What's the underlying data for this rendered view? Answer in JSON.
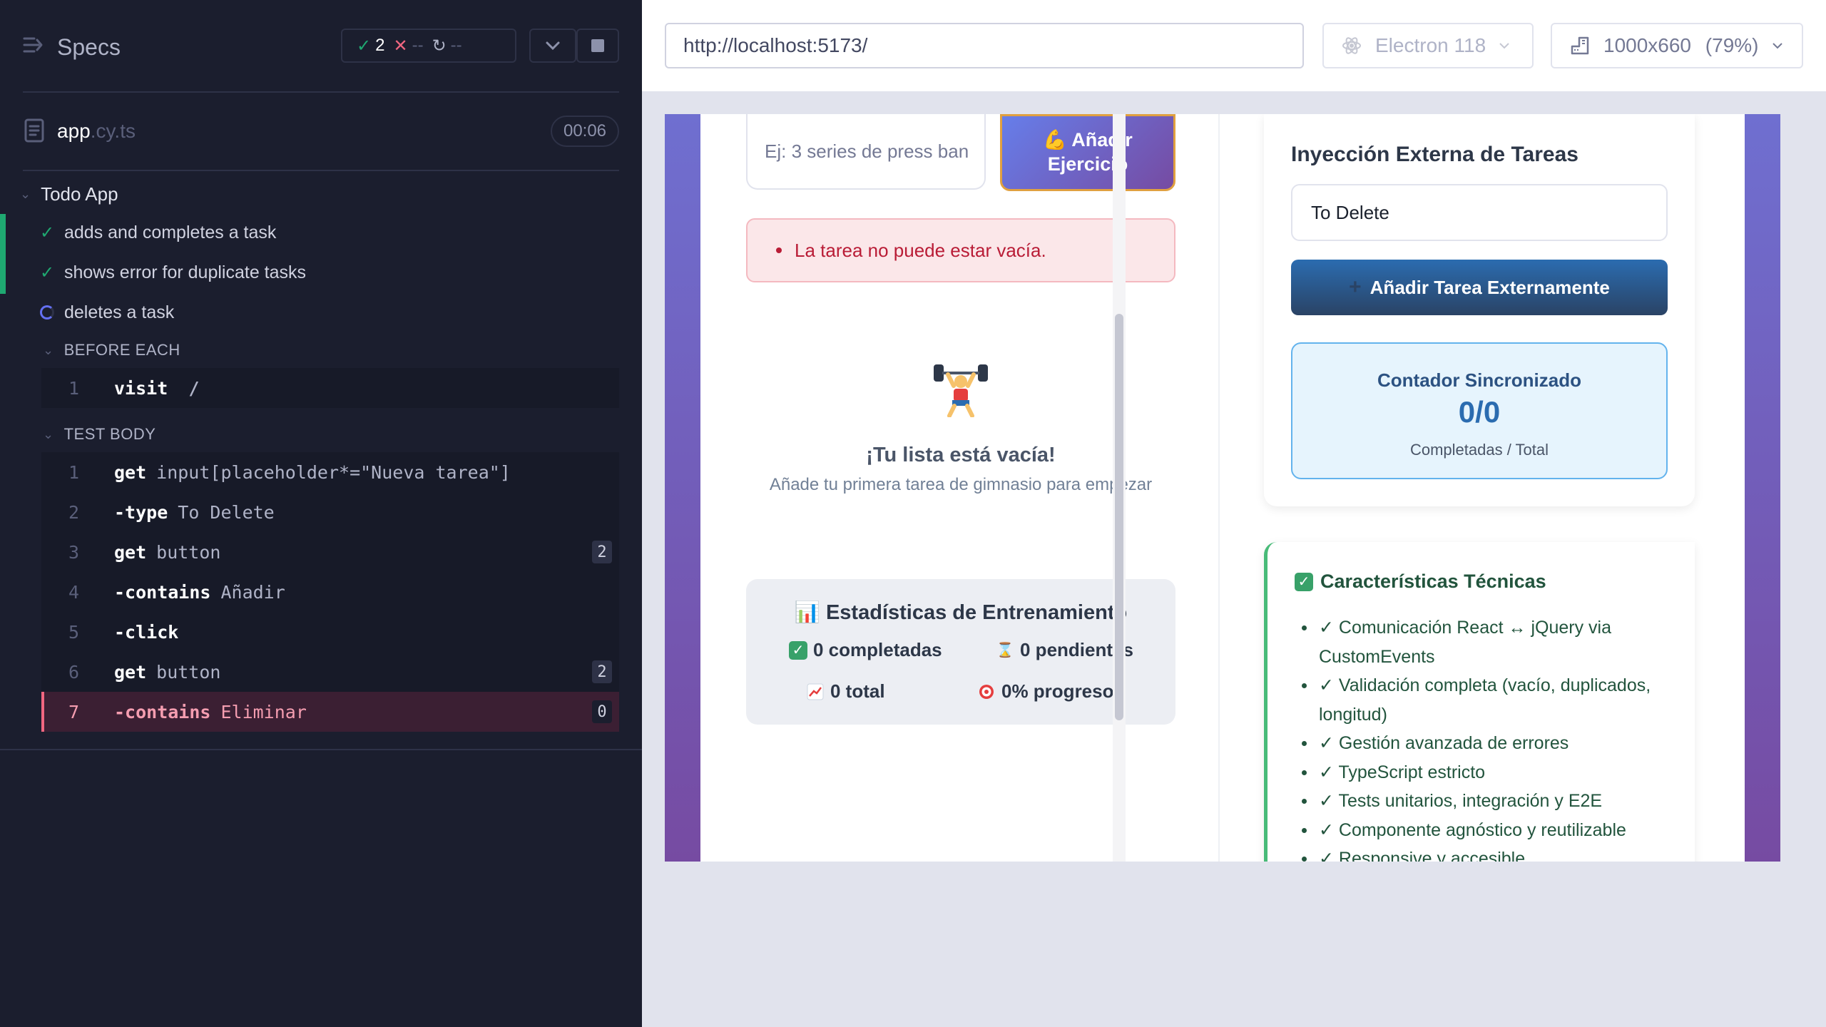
{
  "runner": {
    "title": "Specs",
    "stats": {
      "passed": "2",
      "failed": "--",
      "pending": "--"
    },
    "file": {
      "name": "app",
      "ext": ".cy.ts",
      "duration": "00:06"
    },
    "suite": "Todo App",
    "tests": [
      {
        "label": "adds and completes a task",
        "state": "passed"
      },
      {
        "label": "shows error for duplicate tasks",
        "state": "passed"
      },
      {
        "label": "deletes a task",
        "state": "running"
      }
    ],
    "before_each": {
      "label": "BEFORE EACH",
      "commands": [
        {
          "num": "1",
          "name": "visit",
          "msg": "/"
        }
      ]
    },
    "test_body": {
      "label": "TEST BODY",
      "commands": [
        {
          "num": "1",
          "name": "get",
          "msg": "input[placeholder*=\"Nueva tarea\"]",
          "badge": ""
        },
        {
          "num": "2",
          "name": "-type",
          "msg": "To Delete",
          "badge": ""
        },
        {
          "num": "3",
          "name": "get",
          "msg": "button",
          "badge": "2"
        },
        {
          "num": "4",
          "name": "-contains",
          "msg": "Añadir",
          "badge": ""
        },
        {
          "num": "5",
          "name": "-click",
          "msg": "",
          "badge": ""
        },
        {
          "num": "6",
          "name": "get",
          "msg": "button",
          "badge": "2"
        },
        {
          "num": "7",
          "name": "-contains",
          "msg": "Eliminar",
          "badge": "0",
          "failed": true
        }
      ]
    }
  },
  "aut": {
    "url": "http://localhost:5173/",
    "browser": "Electron 118",
    "viewport_size": "1000x660",
    "viewport_scale": "(79%)"
  },
  "app": {
    "exercise_input_placeholder": "Ej: 3 series de press ban",
    "add_exercise_button": "💪 Añadir Ejercicio",
    "error_message": "La tarea no puede estar vacía.",
    "empty_title": "¡Tu lista está vacía!",
    "empty_subtitle": "Añade tu primera tarea de gimnasio para empezar",
    "stats": {
      "title": "📊 Estadísticas de Entrenamiento",
      "completed": "0 completadas",
      "pending": "0 pendientes",
      "total": "0 total",
      "progress": "0% progreso"
    },
    "external": {
      "title": "Inyección Externa de Tareas",
      "input_value": "To Delete",
      "button": "Añadir Tarea Externamente",
      "counter_title": "Contador Sincronizado",
      "counter_value": "0/0",
      "counter_sub": "Completadas / Total"
    },
    "tech": {
      "title": "Características Técnicas",
      "items": [
        "✓ Comunicación React ↔ jQuery via CustomEvents",
        "✓ Validación completa (vacío, duplicados, longitud)",
        "✓ Gestión avanzada de errores",
        "✓ TypeScript estricto",
        "✓ Tests unitarios, integración y E2E",
        "✓ Componente agnóstico y reutilizable",
        "✓ Responsive y accesible"
      ]
    }
  },
  "colors": {
    "runner_bg": "#1b1e2e",
    "pass_green": "#1fa971",
    "fail_pink": "#f06680",
    "accent_purple": "#667eea",
    "error_red": "#b91c36"
  }
}
